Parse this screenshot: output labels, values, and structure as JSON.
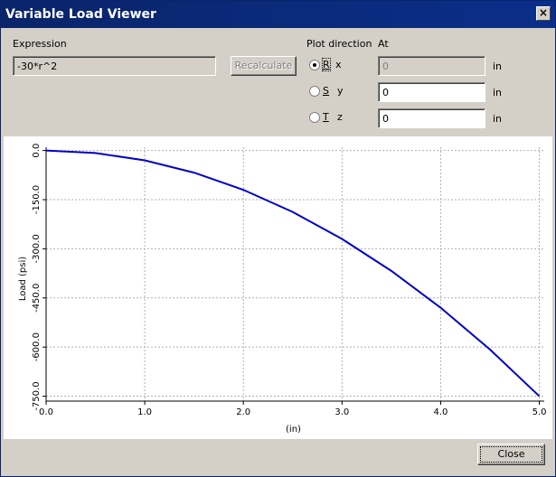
{
  "window": {
    "title": "Variable Load Viewer",
    "close_glyph": "×"
  },
  "expression": {
    "label": "Expression",
    "value": "-30*r^2"
  },
  "recalculate_label": "Recalculate",
  "plot_direction": {
    "label": "Plot direction",
    "options": [
      {
        "letter": "R",
        "axis": "x",
        "selected": true
      },
      {
        "letter": "S",
        "axis": "y",
        "selected": false
      },
      {
        "letter": "T",
        "axis": "z",
        "selected": false
      }
    ]
  },
  "at": {
    "label": "At",
    "fields": [
      {
        "value": "0",
        "unit": "in",
        "disabled": true
      },
      {
        "value": "0",
        "unit": "in",
        "disabled": false
      },
      {
        "value": "0",
        "unit": "in",
        "disabled": false
      }
    ]
  },
  "close_label": "Close",
  "chart_data": {
    "type": "line",
    "title": "",
    "xlabel": "(in)",
    "ylabel": "Load (psi)",
    "xlim": [
      0,
      5.05
    ],
    "ylim": [
      -765,
      10
    ],
    "x_ticks": [
      0,
      1,
      2,
      3,
      4,
      5
    ],
    "x_tick_labels": [
      "0.0",
      "1.0",
      "2.0",
      "3.0",
      "4.0",
      "5.0"
    ],
    "y_ticks": [
      0,
      -150,
      -300,
      -450,
      -600,
      -750
    ],
    "y_tick_labels": [
      "0.0",
      "-150.0",
      "-300.0",
      "-450.0",
      "-600.0",
      "-750.0"
    ],
    "grid": true,
    "series": [
      {
        "color": "#0000cc",
        "x": [
          0,
          0.5,
          1,
          1.5,
          2,
          2.5,
          3,
          3.5,
          4,
          4.5,
          5
        ],
        "y": [
          0,
          -7.5,
          -30,
          -67.5,
          -120,
          -187.5,
          -270,
          -367.5,
          -480,
          -607.5,
          -750
        ]
      }
    ]
  }
}
